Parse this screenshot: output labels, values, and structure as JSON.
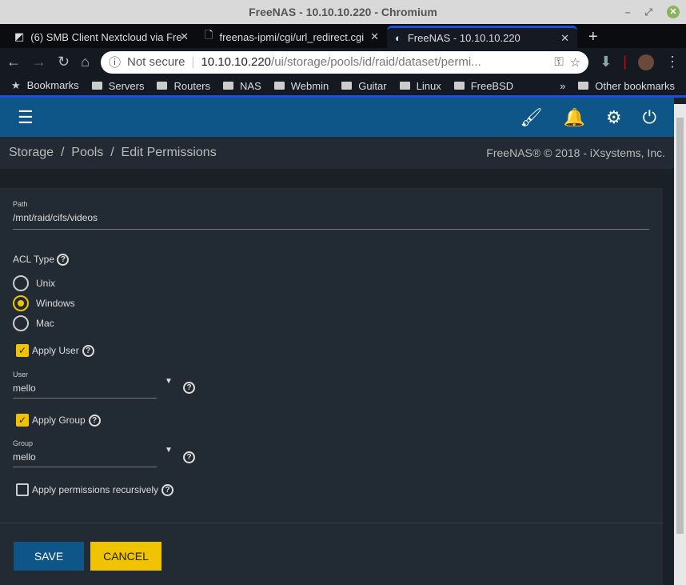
{
  "window": {
    "title": "FreeNAS - 10.10.10.220 - Chromium"
  },
  "tabs": [
    {
      "label": "(6) SMB Client Nextcloud via Fre"
    },
    {
      "label": "freenas-ipmi/cgi/url_redirect.cgi"
    },
    {
      "label": "FreeNAS - 10.10.10.220"
    }
  ],
  "address": {
    "security": "Not secure",
    "host": "10.10.10.220",
    "path": "/ui/storage/pools/id/raid/dataset/permi..."
  },
  "bookmarks": [
    "Bookmarks",
    "Servers",
    "Routers",
    "NAS",
    "Webmin",
    "Guitar",
    "Linux",
    "FreeBSD"
  ],
  "other_bookmarks": "Other bookmarks",
  "breadcrumb": {
    "items": [
      "Storage",
      "Pools",
      "Edit Permissions"
    ],
    "sep": "/"
  },
  "copyright": "FreeNAS® © 2018 - iXsystems, Inc.",
  "form": {
    "path_label": "Path",
    "path_value": "/mnt/raid/cifs/videos",
    "acl_label": "ACL Type",
    "acl_options": [
      "Unix",
      "Windows",
      "Mac"
    ],
    "acl_selected": "Windows",
    "apply_user": "Apply User",
    "user_label": "User",
    "user_value": "mello",
    "apply_group": "Apply Group",
    "group_label": "Group",
    "group_value": "mello",
    "recursive": "Apply permissions recursively"
  },
  "buttons": {
    "save": "SAVE",
    "cancel": "CANCEL"
  },
  "colors": {
    "accent": "#f0c300",
    "primary": "#0e5688"
  }
}
